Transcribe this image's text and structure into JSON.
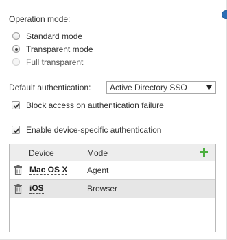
{
  "operation_mode": {
    "label": "Operation mode:",
    "options": [
      {
        "label": "Standard mode",
        "checked": false,
        "disabled": false
      },
      {
        "label": "Transparent mode",
        "checked": true,
        "disabled": false
      },
      {
        "label": "Full transparent",
        "checked": false,
        "disabled": true
      }
    ]
  },
  "authentication": {
    "default_label": "Default authentication:",
    "selected": "Active Directory SSO",
    "block_access_label": "Block access on authentication failure",
    "block_access_checked": true,
    "device_specific_label": "Enable device-specific authentication",
    "device_specific_checked": true
  },
  "device_table": {
    "headers": {
      "device": "Device",
      "mode": "Mode"
    },
    "add_icon": "plus-icon",
    "rows": [
      {
        "device": "Mac OS X",
        "mode": "Agent",
        "selected": false
      },
      {
        "device": "iOS",
        "mode": "Browser",
        "selected": true
      }
    ]
  },
  "colors": {
    "accent_green": "#4caf3f",
    "selection_row": "#e6e6e6"
  }
}
